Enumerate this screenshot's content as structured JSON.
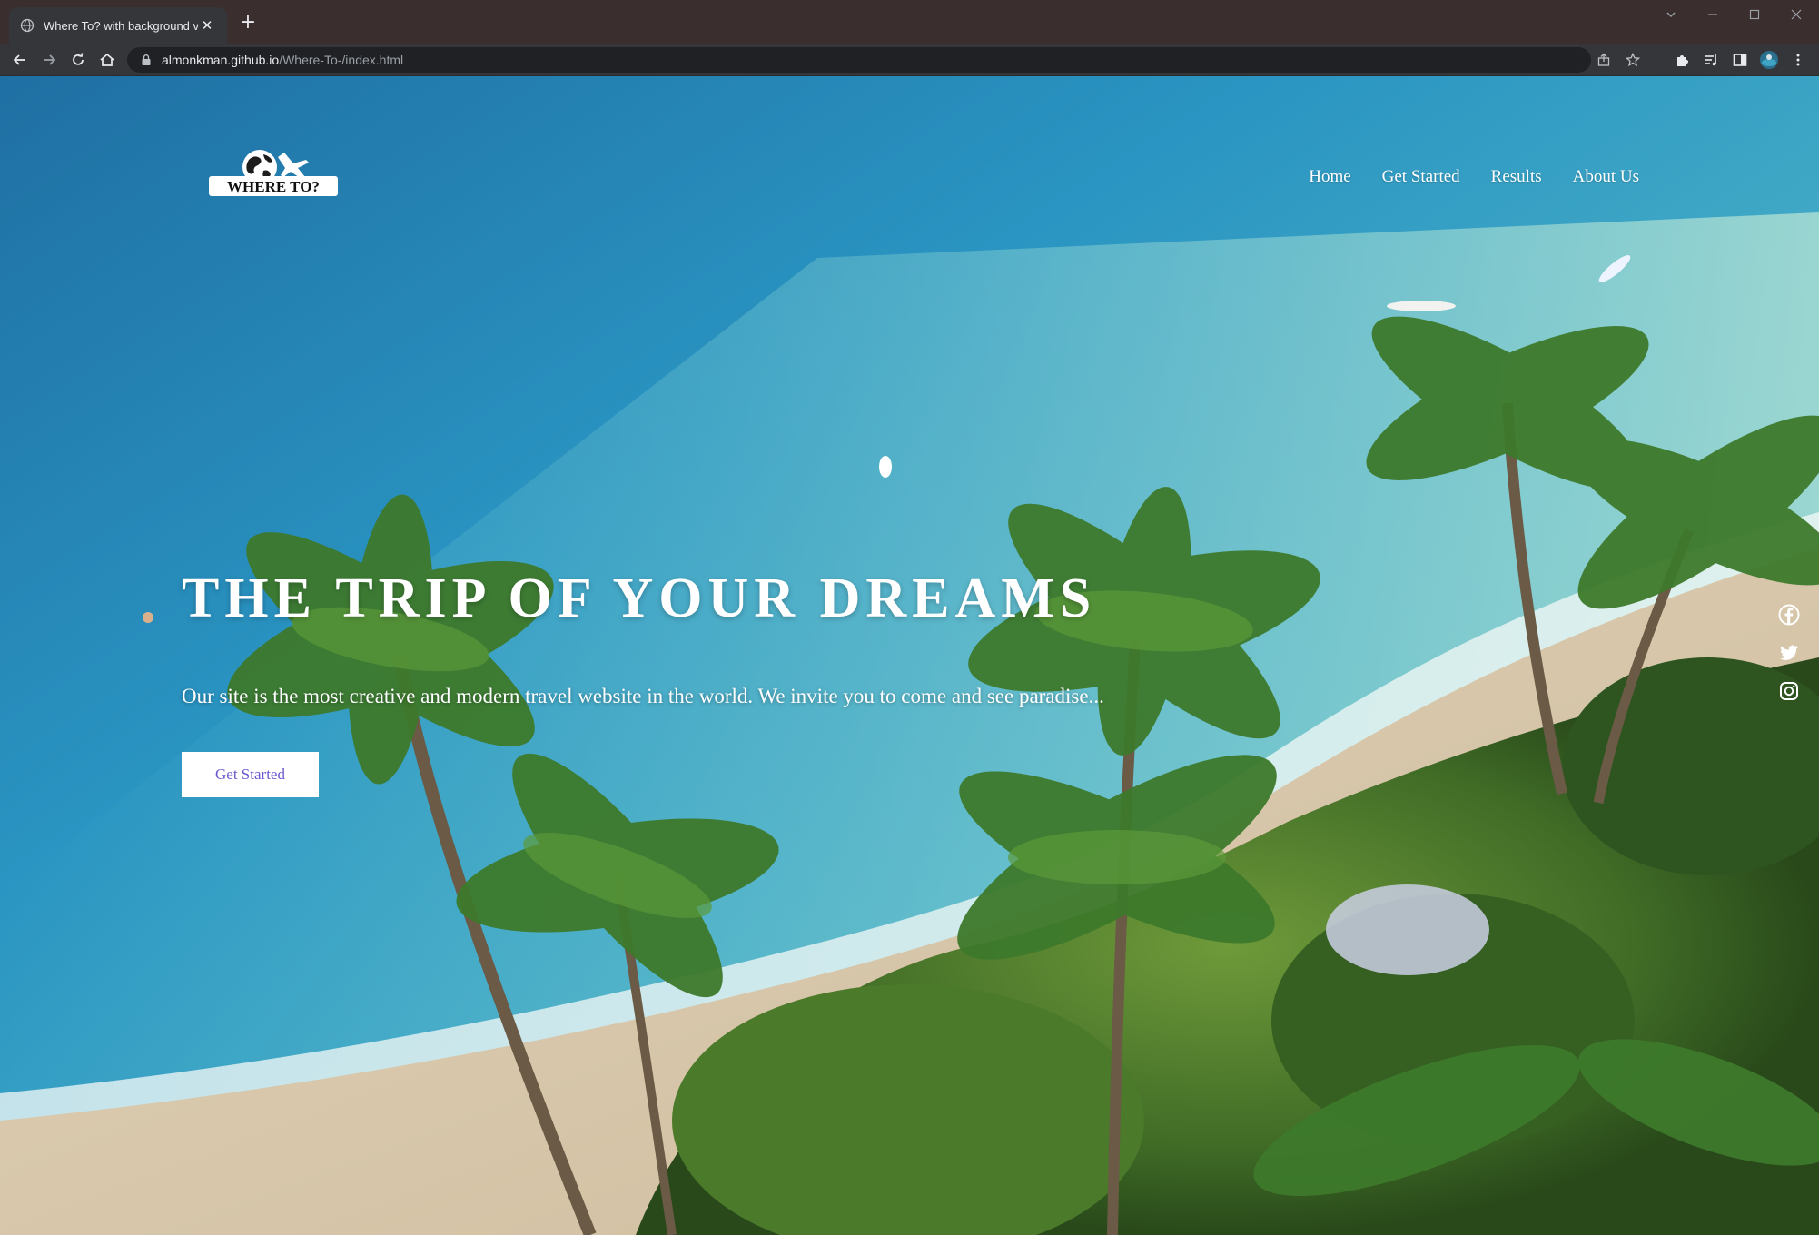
{
  "browser": {
    "tab_title": "Where To? with background vide",
    "url_host": "almonkman.github.io",
    "url_path": "/Where-To-/index.html"
  },
  "site": {
    "logo_text": "WHERE TO?",
    "nav": [
      "Home",
      "Get Started",
      "Results",
      "About Us"
    ],
    "hero": {
      "title": "THE TRIP OF YOUR DREAMS",
      "subtitle": "Our site is the most creative and modern travel website in the world. We invite you to come and see paradise...",
      "cta_label": "Get Started",
      "cta_color": "#6a5acd"
    },
    "social_icons": [
      "facebook-icon",
      "twitter-icon",
      "instagram-icon"
    ]
  }
}
